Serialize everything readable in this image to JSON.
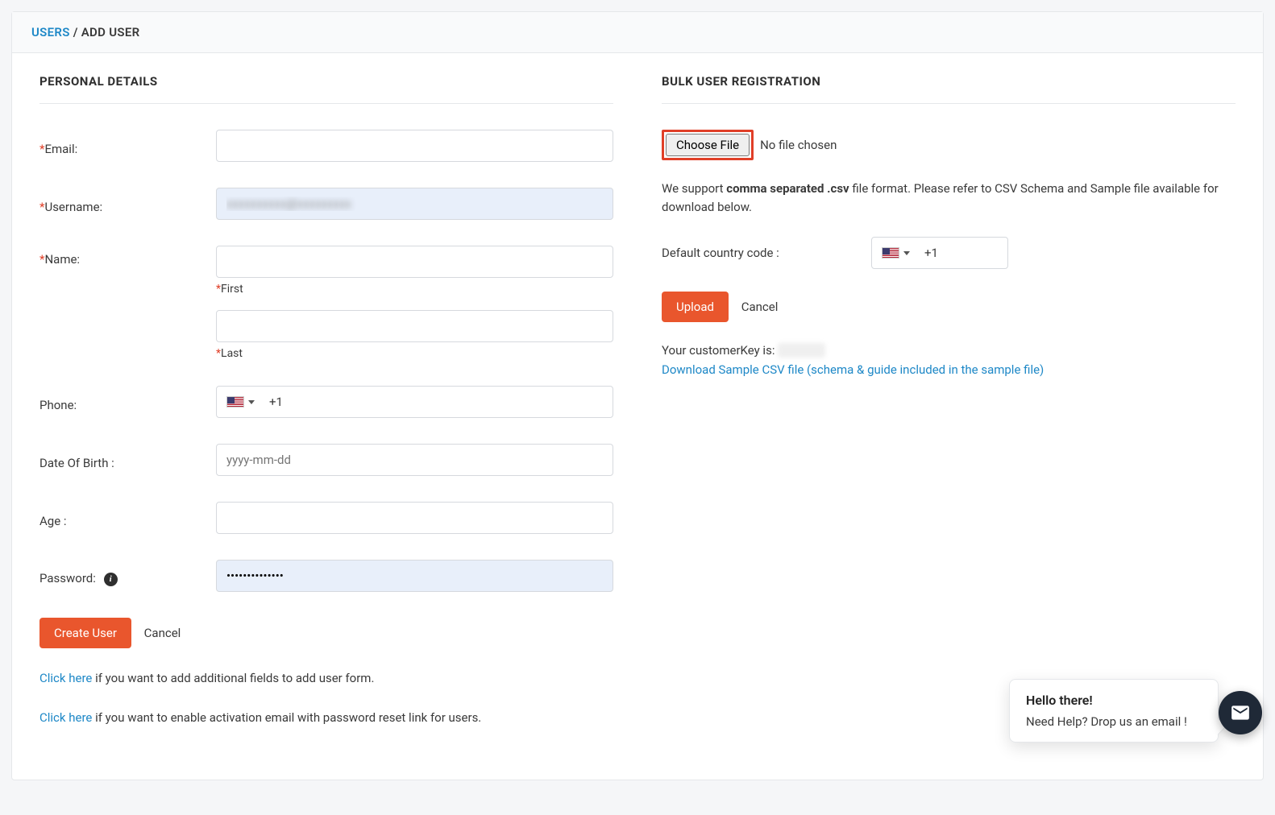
{
  "breadcrumb": {
    "root": "USERS",
    "sep": "/",
    "current": "ADD USER"
  },
  "left": {
    "title": "PERSONAL DETAILS",
    "labels": {
      "email": "Email:",
      "username": "Username:",
      "name": "Name:",
      "first": "First",
      "last": "Last",
      "phone": "Phone:",
      "dob": "Date Of Birth :",
      "age": "Age :",
      "password": "Password:"
    },
    "values": {
      "username": "xxxxxxxxxx@xxxxxxxxx",
      "phone_code": "+1",
      "password": "••••••••••••••"
    },
    "placeholders": {
      "dob": "yyyy-mm-dd"
    },
    "buttons": {
      "create": "Create User",
      "cancel": "Cancel"
    },
    "helpers": {
      "click_here": "Click here",
      "additional_fields": " if you want to add additional fields to add user form.",
      "activation_email": " if you want to enable activation email with password reset link for users."
    }
  },
  "right": {
    "title": "BULK USER REGISTRATION",
    "file": {
      "button": "Choose File",
      "status": "No file chosen"
    },
    "support_text_pre": "We support ",
    "support_text_bold": "comma separated .csv",
    "support_text_post": " file format. Please refer to CSV Schema and Sample file available for download below.",
    "country_label": "Default country code :",
    "country_code": "+1",
    "buttons": {
      "upload": "Upload",
      "cancel": "Cancel"
    },
    "customer_key_label": "Your customerKey is: ",
    "customer_key_value": "XXXXX",
    "download_link": "Download Sample CSV file (schema & guide included in the sample file)"
  },
  "chat": {
    "title": "Hello there!",
    "body": "Need Help? Drop us an email !"
  }
}
